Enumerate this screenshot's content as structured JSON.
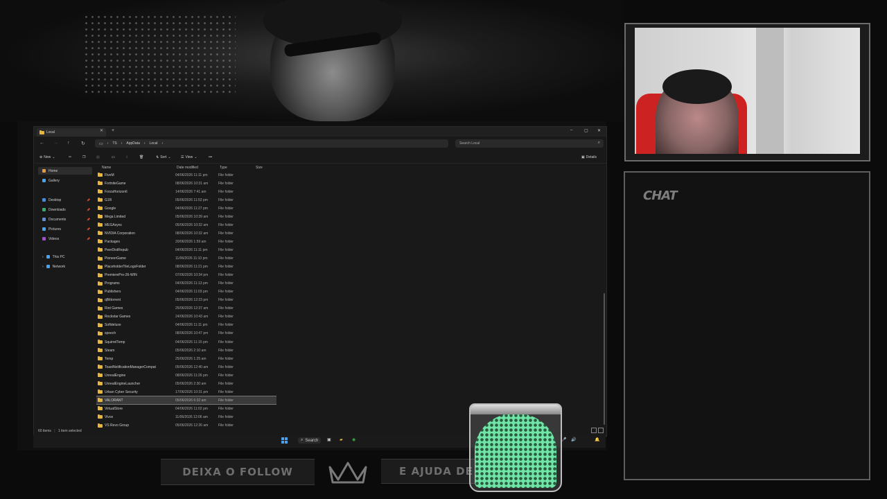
{
  "explorer": {
    "tab_title": "Local",
    "breadcrumb": [
      "TS",
      "AppData",
      "Local"
    ],
    "search_placeholder": "Search Local",
    "cmd": {
      "new": "New",
      "sort": "Sort",
      "view": "View",
      "details": "Details"
    },
    "sidebar": {
      "home": "Home",
      "gallery": "Gallery",
      "desktop": "Desktop",
      "downloads": "Downloads",
      "documents": "Documents",
      "pictures": "Pictures",
      "videos": "Videos",
      "this_pc": "This PC",
      "network": "Network"
    },
    "columns": {
      "name": "Name",
      "date": "Date modified",
      "type": "Type",
      "size": "Size"
    },
    "files": [
      {
        "name": "FiveM",
        "date": "04/06/2026 11:11 pm",
        "type": "File folder"
      },
      {
        "name": "FortniteGame",
        "date": "08/06/2026 10:31 am",
        "type": "File folder"
      },
      {
        "name": "ForzaHorizon6",
        "date": "14/06/2026 7:41 am",
        "type": "File folder"
      },
      {
        "name": "G1R",
        "date": "05/06/2026 11:52 pm",
        "type": "File folder"
      },
      {
        "name": "Google",
        "date": "04/06/2026 11:27 pm",
        "type": "File folder"
      },
      {
        "name": "Mega Limited",
        "date": "05/06/2026 10:39 am",
        "type": "File folder"
      },
      {
        "name": "MEGAsync",
        "date": "05/06/2026 10:32 am",
        "type": "File folder"
      },
      {
        "name": "NVIDIA Corporation",
        "date": "08/06/2026 10:32 am",
        "type": "File folder"
      },
      {
        "name": "Packages",
        "date": "20/06/2026 1:59 am",
        "type": "File folder"
      },
      {
        "name": "PeerDistRepub",
        "date": "04/06/2026 11:11 pm",
        "type": "File folder"
      },
      {
        "name": "PioneerGame",
        "date": "11/06/2026 11:10 pm",
        "type": "File folder"
      },
      {
        "name": "PlaceholderTileLogoFolder",
        "date": "08/06/2026 11:21 pm",
        "type": "File folder"
      },
      {
        "name": "PremierePro-26-WIN",
        "date": "07/06/2026 10:34 pm",
        "type": "File folder"
      },
      {
        "name": "Programs",
        "date": "04/06/2026 11:13 pm",
        "type": "File folder"
      },
      {
        "name": "Publishers",
        "date": "04/06/2026 11:03 pm",
        "type": "File folder"
      },
      {
        "name": "qBittorrent",
        "date": "05/06/2026 12:23 pm",
        "type": "File folder"
      },
      {
        "name": "Riot Games",
        "date": "25/06/2026 12:37 am",
        "type": "File folder"
      },
      {
        "name": "Rockstar Games",
        "date": "24/06/2026 10:43 am",
        "type": "File folder"
      },
      {
        "name": "Softdeluxe",
        "date": "04/06/2026 11:11 pm",
        "type": "File folder"
      },
      {
        "name": "speech",
        "date": "08/06/2026 10:47 pm",
        "type": "File folder"
      },
      {
        "name": "SquirrelTemp",
        "date": "04/06/2026 11:15 pm",
        "type": "File folder"
      },
      {
        "name": "Steam",
        "date": "05/06/2026 2:10 am",
        "type": "File folder"
      },
      {
        "name": "Temp",
        "date": "25/06/2026 1:25 am",
        "type": "File folder"
      },
      {
        "name": "ToastNotificationManagerCompat",
        "date": "05/06/2026 12:40 am",
        "type": "File folder"
      },
      {
        "name": "UnrealEngine",
        "date": "08/06/2026 11:26 pm",
        "type": "File folder"
      },
      {
        "name": "UnrealEngineLauncher",
        "date": "05/06/2026 2:30 am",
        "type": "File folder"
      },
      {
        "name": "Urban Cyber Security",
        "date": "17/06/2026 10:31 pm",
        "type": "File folder"
      },
      {
        "name": "VALORANT",
        "date": "05/06/2026 6:32 am",
        "type": "File folder",
        "selected": true
      },
      {
        "name": "VirtualStore",
        "date": "04/06/2026 11:02 pm",
        "type": "File folder"
      },
      {
        "name": "Vivox",
        "date": "11/06/2026 12:06 am",
        "type": "File folder"
      },
      {
        "name": "VS Revo Group",
        "date": "05/06/2026 12:26 am",
        "type": "File folder"
      }
    ],
    "status_items": "60 items",
    "status_selected": "1 item selected"
  },
  "taskbar": {
    "search": "Search"
  },
  "chat": {
    "title": "CHAT"
  },
  "banner": {
    "left": "DEIXA O FOLLOW",
    "right": "E AJUDA DE"
  },
  "colors": {
    "folder": "#e8b63a",
    "accent": "#4aa3f0",
    "jar_fill": "#6fe6a8"
  }
}
